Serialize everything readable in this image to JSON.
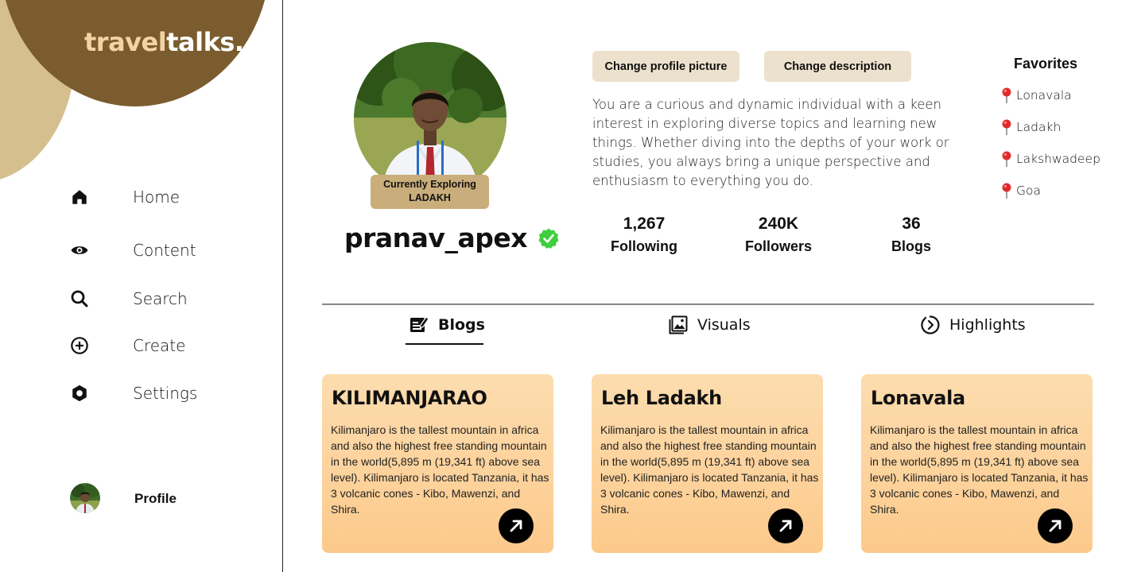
{
  "brand": {
    "logo_part1": "travel",
    "logo_part2": "talks."
  },
  "sidebar": {
    "items": [
      {
        "label": "Home",
        "icon": "home-icon"
      },
      {
        "label": "Content",
        "icon": "eye-icon"
      },
      {
        "label": "Search",
        "icon": "search-icon"
      },
      {
        "label": "Create",
        "icon": "plus-circle-icon"
      },
      {
        "label": "Settings",
        "icon": "gear-icon"
      }
    ],
    "profile_label": "Profile"
  },
  "profile": {
    "exploring_line1": "Currently Exploring",
    "exploring_line2": "LADAKH",
    "username": "pranav_apex",
    "verified_icon": "verified-badge-icon",
    "change_picture": "Change profile picture",
    "change_description": "Change description",
    "description": "You are a curious and dynamic individual with a keen interest in exploring diverse topics and learning new things. Whether diving into the depths of your work or studies, you always bring a unique perspective and enthusiasm to everything you do.",
    "stats": [
      {
        "value": "1,267",
        "label": "Following"
      },
      {
        "value": "240K",
        "label": "Followers"
      },
      {
        "value": "36",
        "label": "Blogs"
      }
    ]
  },
  "favorites": {
    "title": "Favorites",
    "items": [
      "Lonavala",
      "Ladakh",
      "Lakshwadeep",
      "Goa"
    ]
  },
  "tabs": [
    {
      "label": "Blogs",
      "icon": "edit-icon",
      "active": true
    },
    {
      "label": "Visuals",
      "icon": "gallery-icon",
      "active": false
    },
    {
      "label": "Highlights",
      "icon": "highlights-icon",
      "active": false
    }
  ],
  "cards": [
    {
      "title": "KILIMANJARAO",
      "body": "Kilimanjaro is the tallest mountain in africa and also the highest free standing mountain in the world(5,895 m (19,341 ft) above sea level). Kilimanjaro is located Tanzania, it has 3 volcanic cones - Kibo, Mawenzi, and Shira."
    },
    {
      "title": "Leh Ladakh",
      "body": "Kilimanjaro is the tallest mountain in africa and also the highest free standing mountain in the world(5,895 m (19,341 ft) above sea level). Kilimanjaro is located Tanzania, it has 3 volcanic cones - Kibo, Mawenzi, and Shira."
    },
    {
      "title": "Lonavala",
      "body": "Kilimanjaro is the tallest mountain in africa and also the highest free standing mountain in the world(5,895 m (19,341 ft) above sea level). Kilimanjaro is located Tanzania, it has 3 volcanic cones - Kibo, Mawenzi, and Shira."
    }
  ],
  "colors": {
    "brand_dark": "#7a5c2e",
    "brand_light": "#d6bf8f",
    "card_bg": "#fdd29b",
    "button_bg": "#ece1cd",
    "verified_green": "#3ecf3e"
  }
}
